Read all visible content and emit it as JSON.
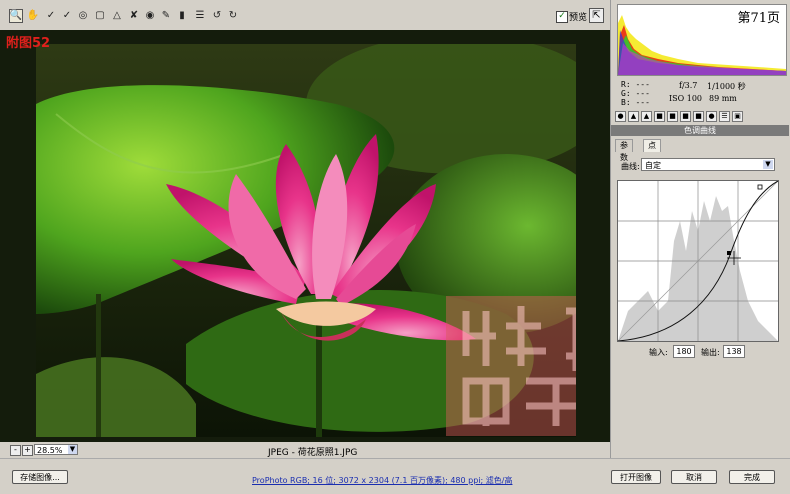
{
  "toolbar": {
    "tools": [
      "zoom-tool",
      "hand-tool",
      "white-balance-tool",
      "color-sampler-tool",
      "target-adjust-tool",
      "crop-tool",
      "straighten-tool",
      "spot-removal-tool",
      "red-eye-tool",
      "adjustment-brush-tool",
      "graduated-filter-tool",
      "preferences-tool",
      "rotate-left-tool",
      "rotate-right-tool"
    ],
    "preview_label": "预览",
    "preview_checked": "✓"
  },
  "overlay": {
    "page_label": "附图52"
  },
  "image_bar": {
    "minus": "-",
    "plus": "+",
    "zoom_value": "28.5%",
    "filename": "JPEG - 荷花原照1.JPG"
  },
  "info": {
    "page_number": "第71页",
    "r": "R:  ---",
    "g": "G:  ---",
    "b": "B:  ---",
    "aperture": "f/3.7",
    "shutter": "1/1000 秒",
    "iso": "ISO 100",
    "focal": "89 mm"
  },
  "panel": {
    "title": "色调曲线",
    "subtabs": [
      "参数",
      "点"
    ],
    "curve_label": "曲线:",
    "curve_value": "自定",
    "input_label": "输入:",
    "input_value": "180",
    "output_label": "输出:",
    "output_value": "138"
  },
  "bottom": {
    "save_label": "存储图像...",
    "workflow": "ProPhoto RGB; 16 位; 3072 x 2304 (7.1 百万像素); 480 ppi; 滤色/高",
    "open_label": "打开图像",
    "cancel_label": "取消",
    "done_label": "完成"
  }
}
